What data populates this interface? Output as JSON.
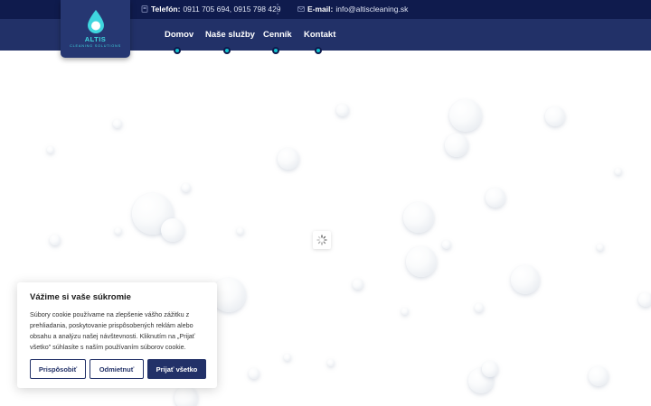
{
  "topbar": {
    "phone_label": "Telefón:",
    "phone_value": "0911 705 694, 0915 798 429",
    "email_label": "E-mail:",
    "email_value": "info@altiscleaning.sk"
  },
  "logo": {
    "brand": "ALTIS",
    "tagline": "CLEANING SOLUTIONS"
  },
  "nav": {
    "items": [
      {
        "label": "Domov"
      },
      {
        "label": "Naše služby"
      },
      {
        "label": "Cenník"
      },
      {
        "label": "Kontakt"
      }
    ]
  },
  "cookie": {
    "title": "Vážime si vaše súkromie",
    "text": "Súbory cookie používame na zlepšenie vášho zážitku z prehliadania, poskytovanie prispôsobených reklám alebo obsahu a analýzu našej návštevnosti. Kliknutím na „Prijať všetko” súhlasíte s naším používaním súborov cookie.",
    "customize_label": "Prispôsobiť",
    "reject_label": "Odmietnuť",
    "accept_label": "Prijať všetko"
  },
  "colors": {
    "topbar_bg": "#0f1b4d",
    "navbar_bg": "#223168",
    "accent": "#12c4cf",
    "button_primary": "#223168"
  },
  "icons": [
    "phone-icon",
    "mail-icon",
    "water-drop-icon",
    "loading-spinner-icon"
  ]
}
